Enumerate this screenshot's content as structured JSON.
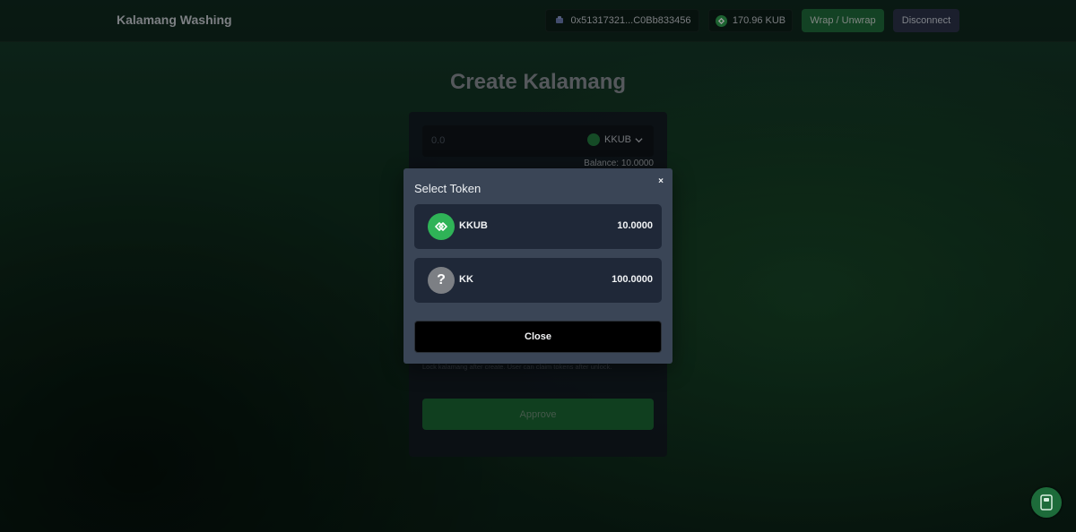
{
  "header": {
    "brand": "Kalamang Washing",
    "wallet_address": "0x51317321...C0Bb833456",
    "native_balance": "170.96 KUB",
    "wrap_label": "Wrap / Unwrap",
    "disconnect_label": "Disconnect"
  },
  "main": {
    "title": "Create Kalamang",
    "amount_placeholder": "0.0",
    "selected_token": "KKUB",
    "balance_text": "Balance: 10.0000",
    "lock_note": "Lock kalamang after create. User can claim tokens after unlock.",
    "approve_label": "Approve"
  },
  "modal": {
    "title": "Select Token",
    "close_x": "×",
    "tokens": [
      {
        "symbol": "KKUB",
        "balance": "10.0000",
        "icon": "kkub-icon"
      },
      {
        "symbol": "KK",
        "balance": "100.0000",
        "icon": "unknown-token-icon"
      }
    ],
    "unknown_glyph": "?",
    "close_label": "Close"
  },
  "colors": {
    "accent_green": "#2fb357",
    "modal_bg": "#3a4556",
    "row_bg": "#1f2838"
  }
}
